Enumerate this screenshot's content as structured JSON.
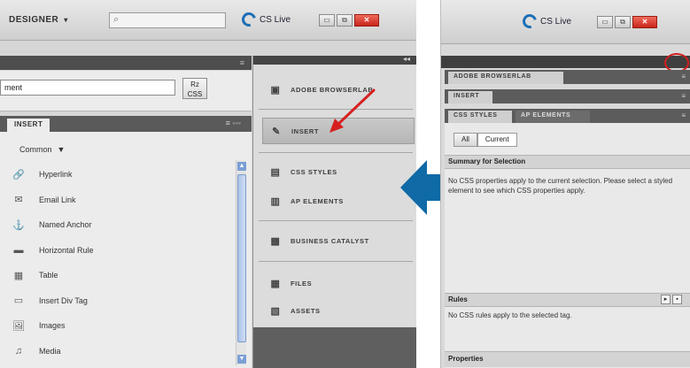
{
  "left_screenshot": {
    "app_bar": {
      "workspace_label": "DESIGNER",
      "workspace_arrow": "▾",
      "search_icon": "⌕",
      "cslive_label": "CS Live",
      "window_controls": [
        "▭",
        "⧉",
        "✕"
      ]
    },
    "properties": {
      "input_value": "ment",
      "button_label": "Rz\nCSS"
    },
    "insert_panel": {
      "tab_label": "INSERT",
      "tab_controls": "≡ ◦◦◦",
      "category": "Common",
      "category_arrow": "▼",
      "items": [
        {
          "label": "Hyperlink",
          "icon": "🔗"
        },
        {
          "label": "Email Link",
          "icon": "✉"
        },
        {
          "label": "Named Anchor",
          "icon": "⚓"
        },
        {
          "label": "Horizontal Rule",
          "icon": "▬"
        },
        {
          "label": "Table",
          "icon": "▦"
        },
        {
          "label": "Insert Div Tag",
          "icon": "▭"
        },
        {
          "label": "Images",
          "icon": "🖼"
        },
        {
          "label": "Media",
          "icon": "♫"
        }
      ]
    },
    "collapsed_panels": {
      "groups": [
        [
          {
            "label": "ADOBE BROWSERLAB",
            "icon": "▣",
            "active": false
          }
        ],
        [
          {
            "label": "INSERT",
            "icon": "✎",
            "active": true
          }
        ],
        [
          {
            "label": "CSS STYLES",
            "icon": "▤",
            "active": false
          },
          {
            "label": "AP ELEMENTS",
            "icon": "▥",
            "active": false
          }
        ],
        [
          {
            "label": "BUSINESS CATALYST",
            "icon": "▩",
            "active": false
          }
        ],
        [
          {
            "label": "FILES",
            "icon": "▦",
            "active": false
          },
          {
            "label": "ASSETS",
            "icon": "▧",
            "active": false
          }
        ]
      ],
      "collapse_glyph": "◂◂"
    }
  },
  "right_screenshot": {
    "app_bar": {
      "cslive_label": "CS Live",
      "window_controls": [
        "▭",
        "⧉",
        "✕"
      ]
    },
    "tabs": {
      "browserlab": "ADOBE BROWSERLAB",
      "insert": "INSERT",
      "css_styles": "CSS STYLES",
      "ap_elements": "AP ELEMENTS"
    },
    "css_panel": {
      "mode_all": "All",
      "mode_current": "Current",
      "summary_title": "Summary for Selection",
      "summary_text": "No CSS properties apply to the current selection.  Please select a styled element to see which CSS properties apply.",
      "rules_title": "Rules",
      "rules_text": "No CSS rules apply to the selected tag.",
      "properties_title": "Properties"
    }
  },
  "colors": {
    "highlight_arrow": "#d62020",
    "transition_arrow": "#0f6aa6",
    "cslive_blue": "#1d6fb6"
  }
}
